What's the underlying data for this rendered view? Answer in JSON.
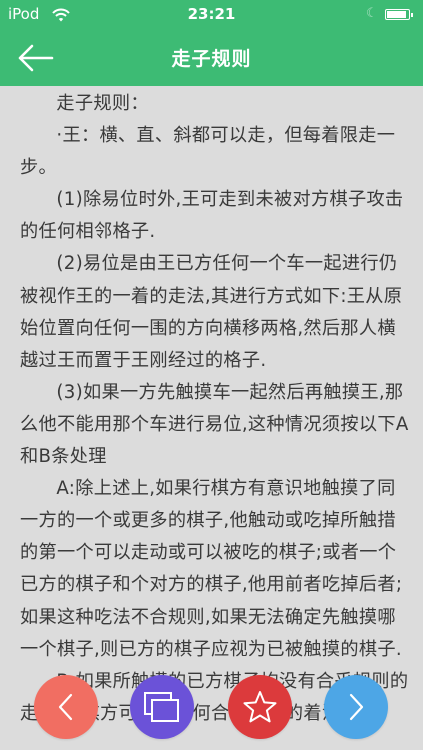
{
  "status_bar": {
    "carrier": "iPod",
    "time": "23:21",
    "battery_level": 0.9
  },
  "nav": {
    "title": "走子规则",
    "back_icon": "arrow-left-icon"
  },
  "article": {
    "heading": "走子规则：",
    "paragraphs": [
      "·王：横、直、斜都可以走，但每着限走一步。",
      "(1)除易位时外,王可走到未被对方棋子攻击的任何相邻格子.",
      "(2)易位是由王已方任何一个车一起进行仍被视作王的一着的走法,其进行方式如下:王从原始位置向任何一围的方向横移两格,然后那人横越过王而置于王刚经过的格子.",
      "(3)如果一方先触摸车一起然后再触摸王,那么他不能用那个车进行易位,这种情况须按以下A和B条处理",
      "A:除上述上,如果行棋方有意识地触摸了同一方的一个或更多的棋子,他触动或吃掉所触措的第一个可以走动或可以被吃的棋子;或者一个已方的棋子和个对方的棋子,他用前者吃掉后者;如果这种吃法不合规则,如果无法确定先触摸哪一个棋子,则已方的棋子应视为已被触摸的棋子.",
      "B:如果所触摸的已方棋子均没有合乎规则的走法,行棋方可以走任何合乎规则的着法."
    ]
  },
  "bottom_buttons": {
    "prev": {
      "icon": "chevron-left-icon",
      "color": "#f16e62"
    },
    "windows": {
      "icon": "windows-icon",
      "color": "#6b52d8"
    },
    "favorite": {
      "icon": "star-icon",
      "color": "#dc3a3c"
    },
    "next": {
      "icon": "chevron-right-icon",
      "color": "#4da6e6"
    }
  },
  "colors": {
    "accent": "#3dbb74",
    "background": "#dcdcdc",
    "text": "#3a3a3a"
  }
}
